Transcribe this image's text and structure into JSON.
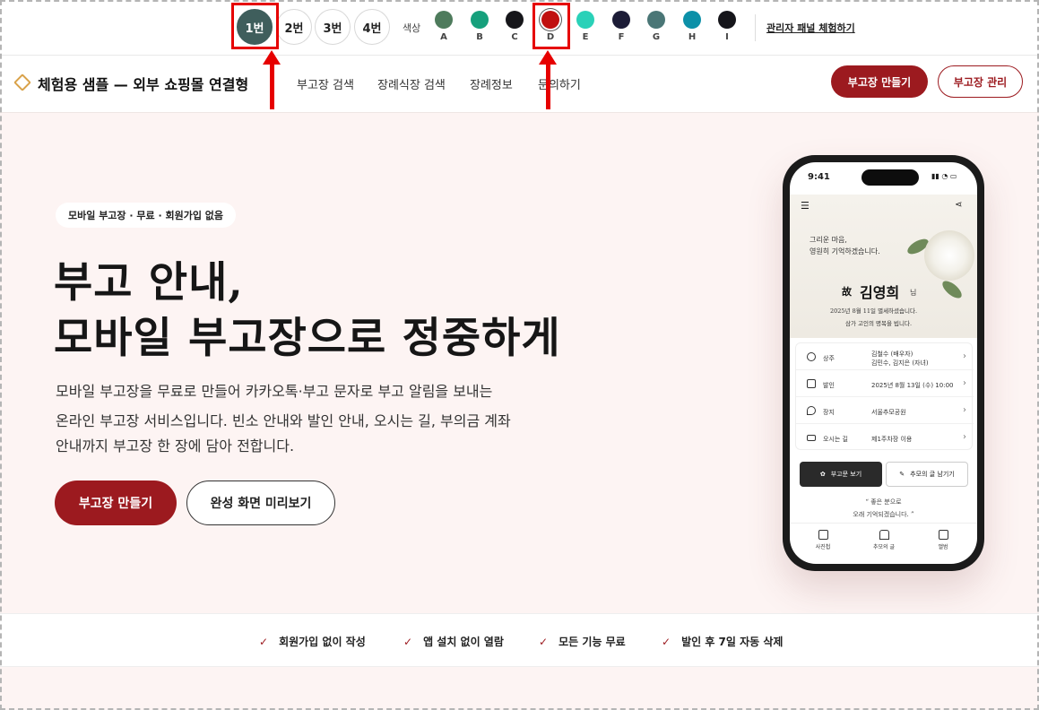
{
  "selector": {
    "versions": [
      "1번",
      "2번",
      "3번",
      "4번"
    ],
    "active_version": "1번",
    "color_label": "색상",
    "swatches": [
      {
        "letter": "A",
        "color": "#4e7b5c"
      },
      {
        "letter": "B",
        "color": "#16a07c"
      },
      {
        "letter": "C",
        "color": "#16161a"
      },
      {
        "letter": "D",
        "color": "#c0100f"
      },
      {
        "letter": "E",
        "color": "#2ad1b8"
      },
      {
        "letter": "F",
        "color": "#1c1c36"
      },
      {
        "letter": "G",
        "color": "#4a7676"
      },
      {
        "letter": "H",
        "color": "#0c90a8"
      },
      {
        "letter": "I",
        "color": "#15151a"
      }
    ],
    "selected_swatch": "D",
    "admin_link": "관리자 패널 체험하기"
  },
  "nav": {
    "brand": "체험용 샘플 — 외부 쇼핑몰 연결형",
    "links": [
      "부고장 검색",
      "장례식장 검색",
      "장례정보",
      "문의하기"
    ],
    "create_button": "부고장 만들기",
    "manage_button": "부고장 관리"
  },
  "hero": {
    "tag": "모바일 부고장 · 무료 · 회원가입 없음",
    "title_line1": "부고 안내,",
    "title_line2": "모바일 부고장으로 정중하게",
    "desc_line1": "모바일 부고장을 무료로 만들어 카카오톡·부고 문자로 부고 알림을 보내는",
    "desc_line2": "온라인 부고장 서비스입니다. 빈소 안내와 발인 안내, 오시는 길, 부의금 계좌",
    "desc_line3": "안내까지 부고장 한 장에 담아 전합니다.",
    "cta_primary": "부고장 만들기",
    "cta_secondary": "완성 화면 미리보기"
  },
  "phone": {
    "time": "9:41",
    "greeting_line1": "그리운 마음,",
    "greeting_line2": "영원히 기억하겠습니다.",
    "prefix": "故",
    "name": "김영희",
    "honorific": "님",
    "date_line": "2025년 8월 11일 별세하셨습니다.",
    "condolence_line": "삼가 고인의 명복을 빕니다.",
    "rows": [
      {
        "label": "상주",
        "value": "김철수 (배우자)",
        "value2": "김민수, 김지은 (자녀)"
      },
      {
        "label": "발인",
        "value": "2025년 8월 13일 (수) 10:00",
        "value2": ""
      },
      {
        "label": "장지",
        "value": "서울추모공원",
        "value2": ""
      },
      {
        "label": "오시는 길",
        "value": "제1주차장 이용",
        "value2": ""
      }
    ],
    "btn_obituary": "부고문 보기",
    "btn_memorial": "추모의 글 남기기",
    "quote_line1": "좋은 분으로",
    "quote_line2": "오래 기억되겠습니다.",
    "tabs": [
      "사진첩",
      "추모의 글",
      "앨범"
    ]
  },
  "features": [
    "회원가입 없이 작성",
    "앱 설치 없이 열람",
    "모든 기능 무료",
    "발인 후 7일 자동 삭제"
  ],
  "check_icon": "✓"
}
